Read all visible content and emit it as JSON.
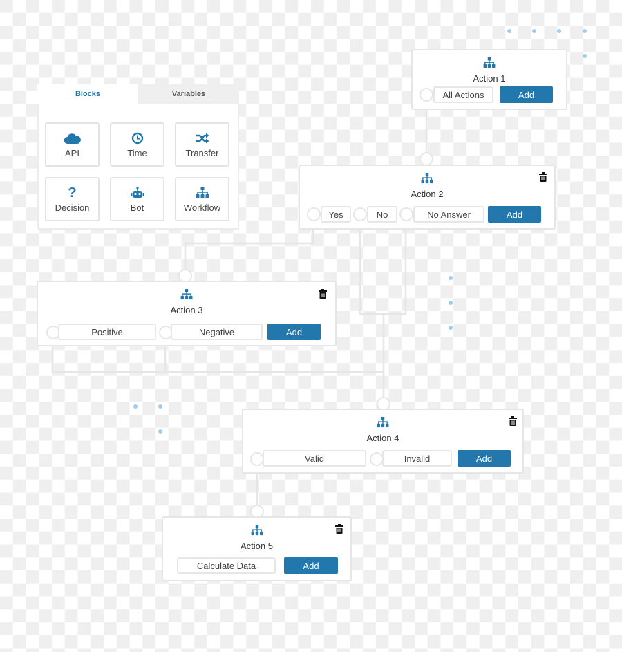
{
  "palette": {
    "tabs": [
      {
        "label": "Blocks",
        "active": true
      },
      {
        "label": "Variables",
        "active": false
      }
    ],
    "blocks": [
      {
        "label": "API",
        "icon": "cloud-icon"
      },
      {
        "label": "Time",
        "icon": "clock-icon"
      },
      {
        "label": "Transfer",
        "icon": "shuffle-icon"
      },
      {
        "label": "Decision",
        "icon": "question-icon"
      },
      {
        "label": "Bot",
        "icon": "robot-icon"
      },
      {
        "label": "Workflow",
        "icon": "sitemap-icon"
      }
    ]
  },
  "actions": [
    {
      "title": "Action 1",
      "icon": "sitemap-icon",
      "deletable": false,
      "options": [
        "All Actions"
      ],
      "add_label": "Add"
    },
    {
      "title": "Action 2",
      "icon": "sitemap-icon",
      "deletable": true,
      "options": [
        "Yes",
        "No",
        "No Answer"
      ],
      "add_label": "Add"
    },
    {
      "title": "Action 3",
      "icon": "sitemap-icon",
      "deletable": true,
      "options": [
        "Positive",
        "Negative"
      ],
      "add_label": "Add"
    },
    {
      "title": "Action 4",
      "icon": "sitemap-icon",
      "deletable": true,
      "options": [
        "Valid",
        "Invalid"
      ],
      "add_label": "Add"
    },
    {
      "title": "Action 5",
      "icon": "sitemap-icon",
      "deletable": true,
      "options": [
        "Calculate Data"
      ],
      "add_label": "Add"
    }
  ],
  "colors": {
    "accent": "#2277ac",
    "connector": "#e6e6e6",
    "decor_dot": "#9ccfee",
    "checker": "#efefef"
  }
}
